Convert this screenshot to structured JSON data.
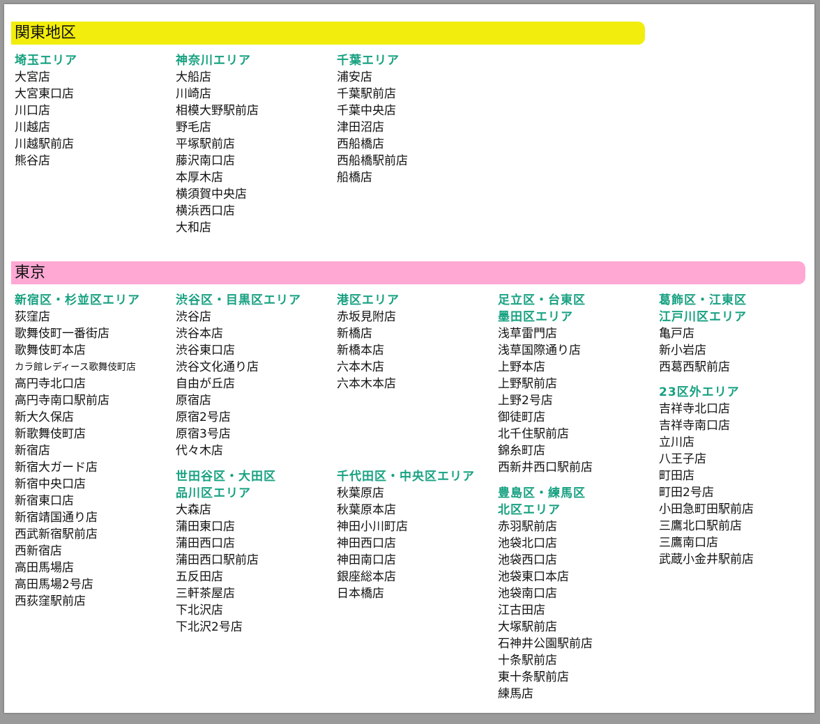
{
  "colors": {
    "kanto_band": "#f2ed0c",
    "tokyo_band": "#ffa8d4",
    "area_heading": "#17a181"
  },
  "kanto": {
    "title": "関東地区",
    "columns": [
      {
        "groups": [
          {
            "heading": [
              "埼玉エリア"
            ],
            "stores": [
              "大宮店",
              "大宮東口店",
              "川口店",
              "川越店",
              "川越駅前店",
              "熊谷店"
            ]
          }
        ]
      },
      {
        "groups": [
          {
            "heading": [
              "神奈川エリア"
            ],
            "stores": [
              "大船店",
              "川崎店",
              "相模大野駅前店",
              "野毛店",
              "平塚駅前店",
              "藤沢南口店",
              "本厚木店",
              "横須賀中央店",
              "横浜西口店",
              "大和店"
            ]
          }
        ]
      },
      {
        "groups": [
          {
            "heading": [
              "千葉エリア"
            ],
            "stores": [
              "浦安店",
              "千葉駅前店",
              "千葉中央店",
              "津田沼店",
              "西船橋店",
              "西船橋駅前店",
              "船橋店"
            ]
          }
        ]
      }
    ]
  },
  "tokyo": {
    "title": "東京",
    "columns": [
      {
        "groups": [
          {
            "heading": [
              "新宿区・杉並区エリア"
            ],
            "stores": [
              "荻窪店",
              "歌舞伎町一番街店",
              "歌舞伎町本店",
              "カラ館レディース歌舞伎町店",
              "高円寺北口店",
              "高円寺南口駅前店",
              "新大久保店",
              "新歌舞伎町店",
              "新宿店",
              "新宿大ガード店",
              "新宿中央口店",
              "新宿東口店",
              "新宿靖国通り店",
              "西武新宿駅前店",
              "西新宿店",
              "高田馬場店",
              "高田馬場2号店",
              "西荻窪駅前店"
            ]
          }
        ]
      },
      {
        "groups": [
          {
            "heading": [
              "渋谷区・目黒区エリア"
            ],
            "stores": [
              "渋谷店",
              "渋谷本店",
              "渋谷東口店",
              "渋谷文化通り店",
              "自由が丘店",
              "原宿店",
              "原宿2号店",
              "原宿3号店",
              "代々木店"
            ]
          },
          {
            "heading": [
              "世田谷区・大田区",
              "品川区エリア"
            ],
            "stores": [
              "大森店",
              "蒲田東口店",
              "蒲田西口店",
              "蒲田西口駅前店",
              "五反田店",
              "三軒茶屋店",
              "下北沢店",
              "下北沢2号店"
            ]
          }
        ]
      },
      {
        "groups": [
          {
            "heading": [
              "港区エリア"
            ],
            "stores": [
              "赤坂見附店",
              "新橋店",
              "新橋本店",
              "六本木店",
              "六本木本店"
            ]
          },
          {
            "heading": [
              "千代田区・中央区エリア"
            ],
            "stores": [
              "秋葉原店",
              "秋葉原本店",
              "神田小川町店",
              "神田西口店",
              "神田南口店",
              "銀座総本店",
              "日本橋店"
            ]
          }
        ]
      },
      {
        "groups": [
          {
            "heading": [
              "足立区・台東区",
              "墨田区エリア"
            ],
            "stores": [
              "浅草雷門店",
              "浅草国際通り店",
              "上野本店",
              "上野駅前店",
              "上野2号店",
              "御徒町店",
              "北千住駅前店",
              "錦糸町店",
              "西新井西口駅前店"
            ]
          },
          {
            "heading": [
              "豊島区・練馬区",
              "北区エリア"
            ],
            "stores": [
              "赤羽駅前店",
              "池袋北口店",
              "池袋西口店",
              "池袋東口本店",
              "池袋南口店",
              "江古田店",
              "大塚駅前店",
              "石神井公園駅前店",
              "十条駅前店",
              "東十条駅前店",
              "練馬店"
            ]
          }
        ]
      },
      {
        "groups": [
          {
            "heading": [
              "葛飾区・江東区",
              "江戸川区エリア"
            ],
            "stores": [
              "亀戸店",
              "新小岩店",
              "西葛西駅前店"
            ]
          },
          {
            "heading": [
              "23区外エリア"
            ],
            "stores": [
              "吉祥寺北口店",
              "吉祥寺南口店",
              "立川店",
              "八王子店",
              "町田店",
              "町田2号店",
              "小田急町田駅前店",
              "三鷹北口駅前店",
              "三鷹南口店",
              "武蔵小金井駅前店"
            ]
          }
        ]
      }
    ]
  }
}
